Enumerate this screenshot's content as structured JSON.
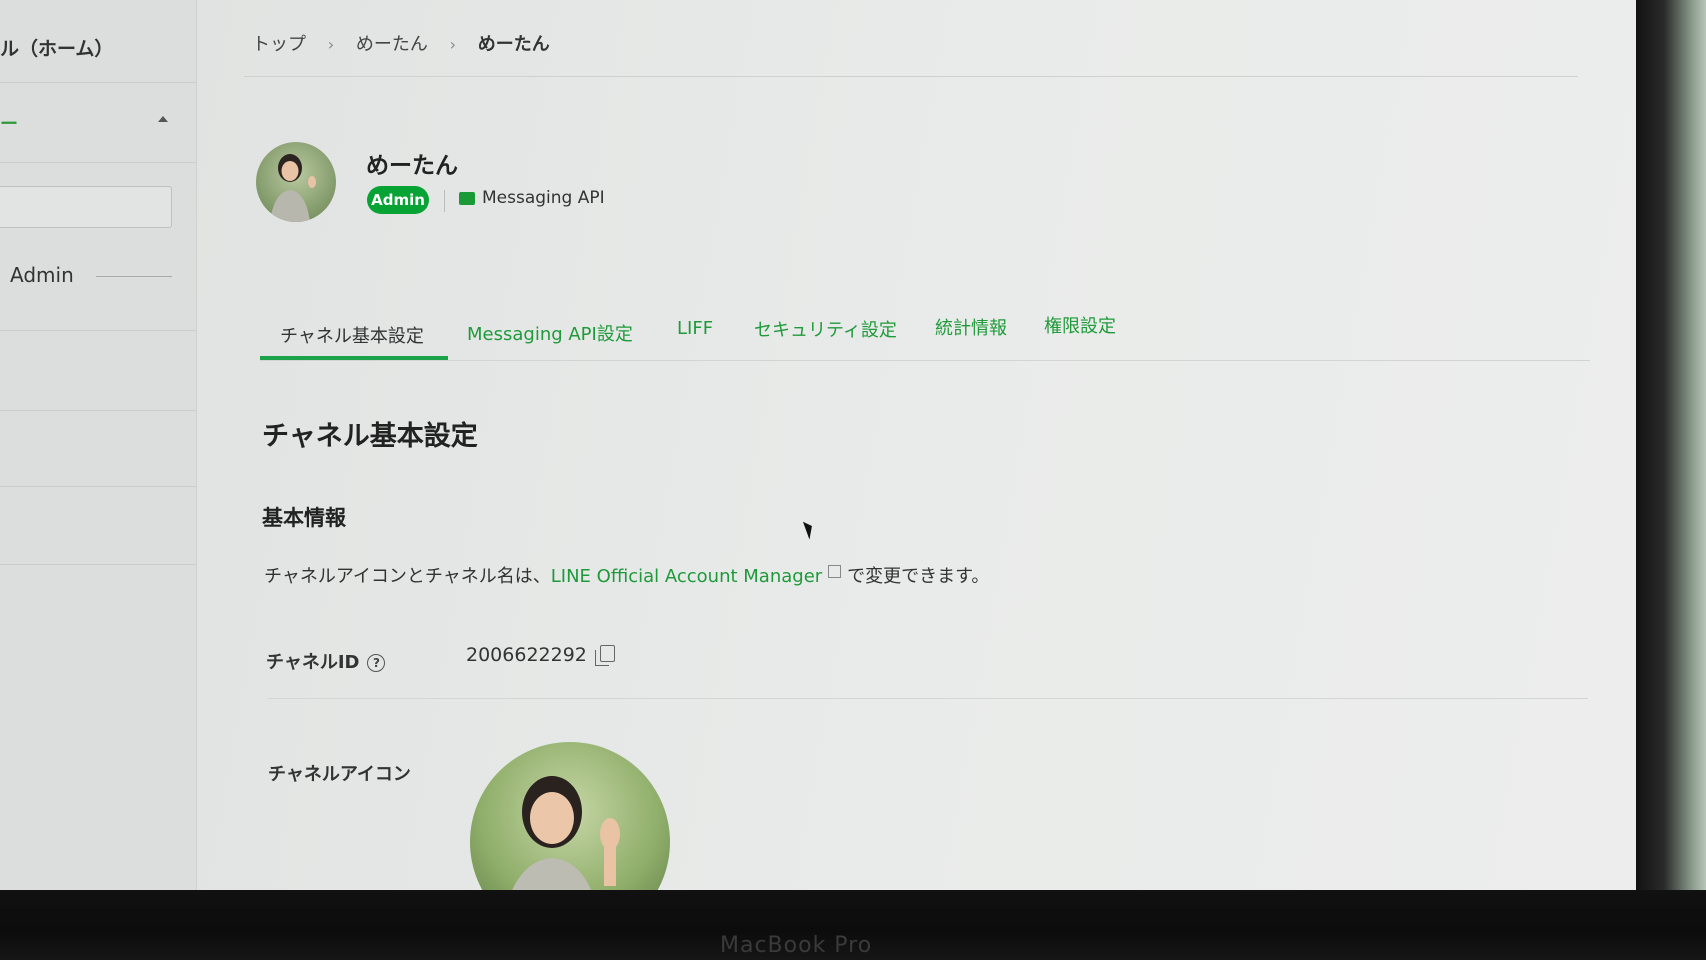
{
  "sidebar": {
    "home_label": "ル（ホーム）",
    "member_label": "ー",
    "role_label": "Admin"
  },
  "breadcrumb": {
    "items": [
      "トップ",
      "めーたん",
      "めーたん"
    ]
  },
  "channel": {
    "name": "めーたん",
    "role_badge": "Admin",
    "type_label": "Messaging API"
  },
  "tabs": [
    {
      "label": "チャネル基本設定",
      "active": true
    },
    {
      "label": "Messaging API設定",
      "active": false
    },
    {
      "label": "LIFF",
      "active": false
    },
    {
      "label": "セキュリティ設定",
      "active": false
    },
    {
      "label": "統計情報",
      "active": false
    },
    {
      "label": "権限設定",
      "active": false
    }
  ],
  "content": {
    "section_title": "チャネル基本設定",
    "subsection_title": "基本情報",
    "info_prefix": "チャネルアイコンとチャネル名は、",
    "info_link": "LINE Official Account Manager",
    "info_suffix": "で変更できます。",
    "channel_id_label": "チャネルID",
    "channel_id_value": "2006622292",
    "channel_icon_label": "チャネルアイコン"
  },
  "device": {
    "label": "MacBook Pro"
  },
  "colors": {
    "accent": "#07a334",
    "link": "#1f9a3a"
  }
}
